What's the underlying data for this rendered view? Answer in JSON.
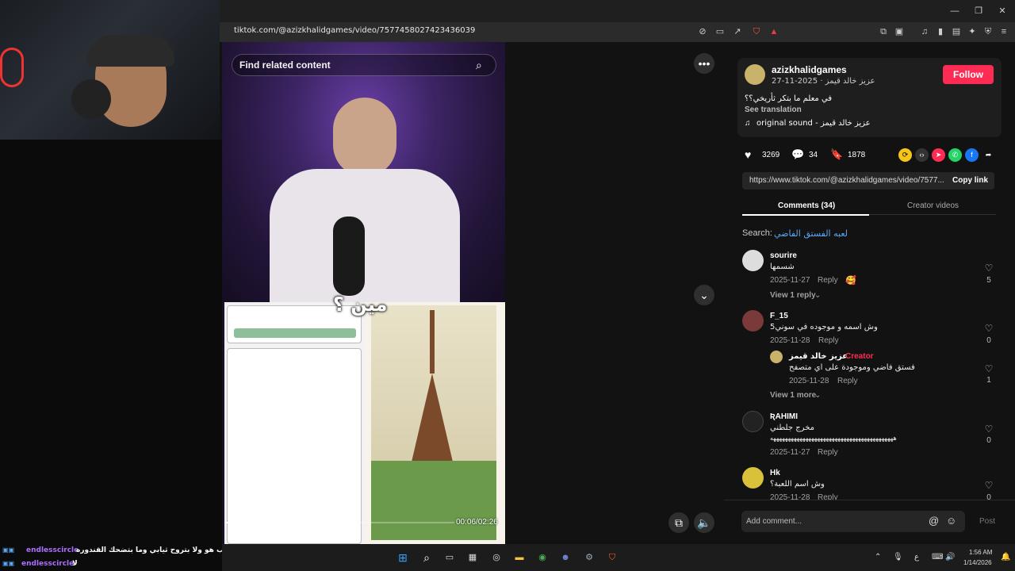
{
  "browser": {
    "url": "tiktok.com/@azizkhalidgames/video/7577458027423436039"
  },
  "video": {
    "search_placeholder": "Find related content",
    "caption_overlay": "مين ؟",
    "timestamp": "00:06/02:26"
  },
  "creator": {
    "username": "azizkhalidgames",
    "display_name_date": "عزيز خالد قيمز · 2025-11-27",
    "follow_label": "Follow",
    "description": "في معلم ما بتكر ثأريخي؟؟",
    "see_translation": "See translation",
    "sound": "original sound - عزيز خالد قيمز"
  },
  "stats": {
    "likes": "3269",
    "comments": "34",
    "saves": "1878"
  },
  "share_icons": [
    "repost-icon",
    "embed-icon",
    "send-icon",
    "whatsapp-icon",
    "facebook-icon",
    "share-arrow-icon"
  ],
  "link": {
    "url": "https://www.tiktok.com/@azizkhalidgames/video/7577...",
    "copy_label": "Copy link"
  },
  "tabs": {
    "comments": "Comments (34)",
    "creator_videos": "Creator videos"
  },
  "search_suggestion": {
    "prefix": "Search:",
    "query": "لعبه الفستق الفاضي"
  },
  "comments": [
    {
      "name": "sourire",
      "text": "شسمها",
      "date": "2025-11-27",
      "reply": "Reply",
      "likes": "5",
      "view_replies": "View 1 reply"
    },
    {
      "name": "F_15",
      "text": "وش اسمه و موجوده في سوني5",
      "date": "2025-11-28",
      "reply": "Reply",
      "likes": "0"
    },
    {
      "name": "عزيز خالد قيمز",
      "badge": "Creator",
      "text": "فستق فاضي وموجودة على اي متصفح",
      "date": "2025-11-28",
      "reply": "Reply",
      "likes": "1",
      "view_more": "View 1 more"
    },
    {
      "name": "ƦAHIMI",
      "text": "مخرج جلطني",
      "text2": "ههههههههههههههههههههههههههههههههههههههههههه",
      "date": "2025-11-27",
      "reply": "Reply",
      "likes": "0"
    },
    {
      "name": "Hk",
      "text": "وش اسم اللعبة؟",
      "date": "2025-11-28",
      "reply": "Reply",
      "likes": "0"
    }
  ],
  "comment_box": {
    "placeholder": "Add comment...",
    "post_label": "Post"
  },
  "chat": [
    {
      "user": "endlesscircle",
      "message": "يارب هو ولا بتروح ثيابي وما بتضحك القندوره"
    },
    {
      "user": "endlesscircle",
      "message": "لا"
    }
  ],
  "taskbar": {
    "lang": "ع",
    "time": "1:56 AM",
    "date": "1/14/2026"
  },
  "colors": {
    "follow": "#fe2c55",
    "creator_badge": "#fe2c55",
    "chat_user": "#a970ff"
  }
}
